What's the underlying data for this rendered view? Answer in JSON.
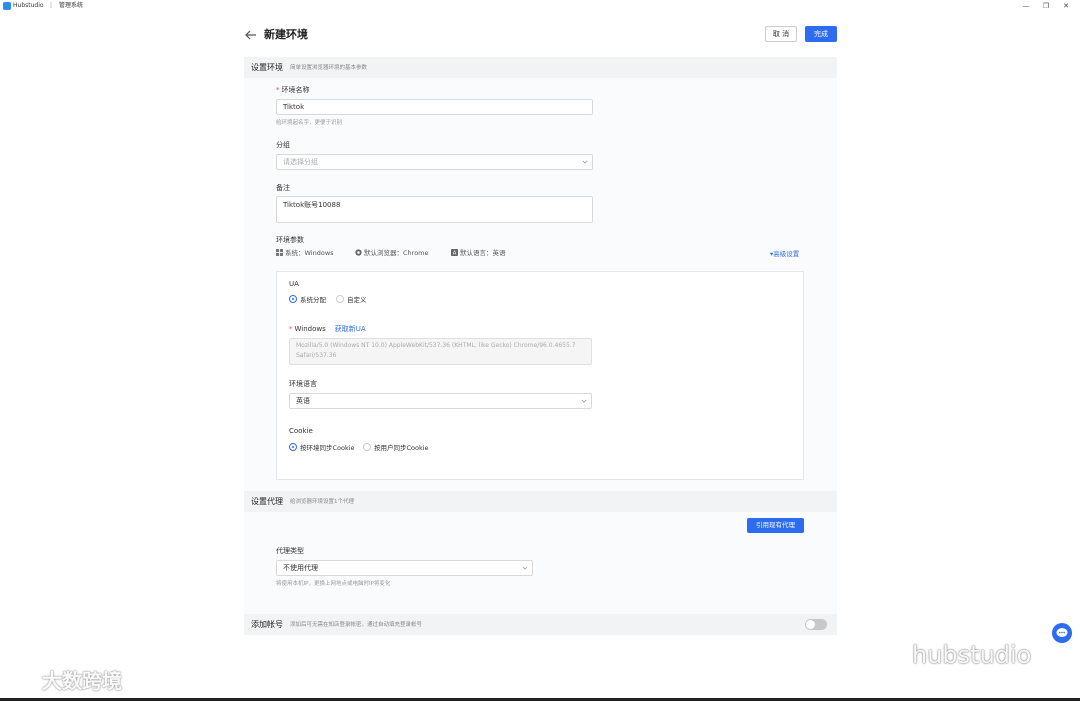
{
  "titlebar": {
    "app_name": "Hubstudio",
    "separator": "|",
    "window_name": "管理系统",
    "minimize": "—",
    "restore": "❐",
    "close": "✕"
  },
  "header": {
    "title": "新建环境",
    "cancel_label": "取 消",
    "done_label": "完成"
  },
  "section_env": {
    "title": "设置环境",
    "desc": "简单设置浏览器环境的基本参数"
  },
  "env_name": {
    "label": "环境名称",
    "value": "Tiktok",
    "hint": "给环境起名字，更便于识别"
  },
  "group": {
    "label": "分组",
    "placeholder": "请选择分组"
  },
  "remark": {
    "label": "备注",
    "value": "Tiktok账号10088"
  },
  "env_params": {
    "label": "环境参数",
    "system": "系统：Windows",
    "browser": "默认浏览器：Chrome",
    "language": "默认语言：英语",
    "advanced": "▾高级设置"
  },
  "ua": {
    "label": "UA",
    "option_system": "系统分配",
    "option_custom": "自定义",
    "windows_label": "Windows",
    "get_new_ua": "获取新UA",
    "ua_string": "Mozilla/5.0 (Windows NT 10.0) AppleWebKit/537.36 (KHTML, like Gecko) Chrome/96.0.4655.7 Safari/537.36"
  },
  "env_language": {
    "label": "环境语言",
    "value": "英语"
  },
  "cookie": {
    "label": "Cookie",
    "option_env": "按环境同步Cookie",
    "option_user": "按用户同步Cookie"
  },
  "section_proxy": {
    "title": "设置代理",
    "desc": "给浏览器环境设置1个代理",
    "use_existing": "引用现有代理"
  },
  "proxy_type": {
    "label": "代理类型",
    "value": "不使用代理",
    "hint": "将使用本机IP，更换上网地点或电脑时IP将变化"
  },
  "section_account": {
    "title": "添加帐号",
    "desc": "添加后可无需在知店登录帐密，通过自动填充登录帐号",
    "toggle_on": false
  },
  "watermarks": {
    "left": "大数跨境",
    "right": "hubstudio"
  },
  "colors": {
    "primary": "#2d6cf0",
    "section_bg": "#f2f3f5",
    "required": "#e5484d"
  }
}
